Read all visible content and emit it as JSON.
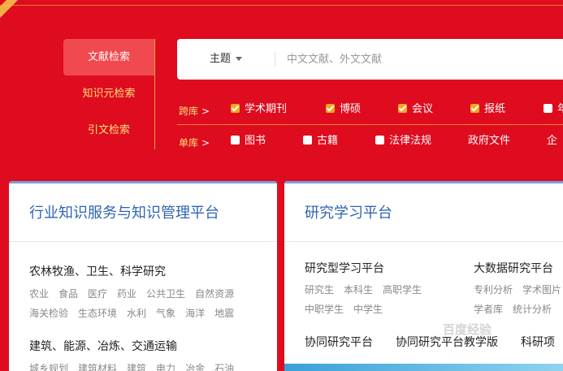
{
  "left_tabs": [
    "文献检索",
    "知识元检索",
    "引文检索"
  ],
  "search": {
    "topic_label": "主题",
    "placeholder": "中文文献、外文文献"
  },
  "cross_db": {
    "label": "跨库",
    "options": [
      {
        "label": "学术期刊",
        "checked": true
      },
      {
        "label": "博硕",
        "checked": true
      },
      {
        "label": "会议",
        "checked": true
      },
      {
        "label": "报纸",
        "checked": true
      },
      {
        "label": "年",
        "checked": false
      }
    ]
  },
  "single_db": {
    "label": "单库",
    "options": [
      {
        "label": "图书",
        "checked": false
      },
      {
        "label": "古籍",
        "checked": false
      },
      {
        "label": "法律法规",
        "checked": false
      },
      {
        "label": "政府文件",
        "checked": null
      },
      {
        "label": "企",
        "checked": null
      }
    ]
  },
  "card1": {
    "title": "行业知识服务与知识管理平台",
    "groups": [
      {
        "title": "农林牧渔、卫生、科学研究",
        "lines": [
          [
            "农业",
            "食品",
            "医疗",
            "药业",
            "公共卫生",
            "自然资源"
          ],
          [
            "海关检验",
            "生态环境",
            "水利",
            "气象",
            "海洋",
            "地震"
          ]
        ]
      },
      {
        "title": "建筑、能源、冶炼、交通运输",
        "lines": [
          [
            "城乡规划",
            "建筑材料",
            "建筑",
            "电力",
            "冶金",
            "石油"
          ]
        ]
      }
    ]
  },
  "card2": {
    "title": "研究学习平台",
    "col1": {
      "title": "研究型学习平台",
      "lines": [
        [
          "研究生",
          "本科生",
          "高职学生"
        ],
        [
          "中职学生",
          "中学生"
        ]
      ]
    },
    "col2": {
      "title": "大数据研究平台",
      "lines": [
        [
          "专利分析",
          "学术图片"
        ],
        [
          "学者库",
          "统计分析"
        ]
      ]
    },
    "bottom": [
      "协同研究平台",
      "协同研究平台教学版",
      "科研项"
    ]
  },
  "watermark": "百度经验",
  "colors": {
    "background": "#df0b1e",
    "accent": "#f5a623",
    "title_blue": "#2f64b3"
  }
}
